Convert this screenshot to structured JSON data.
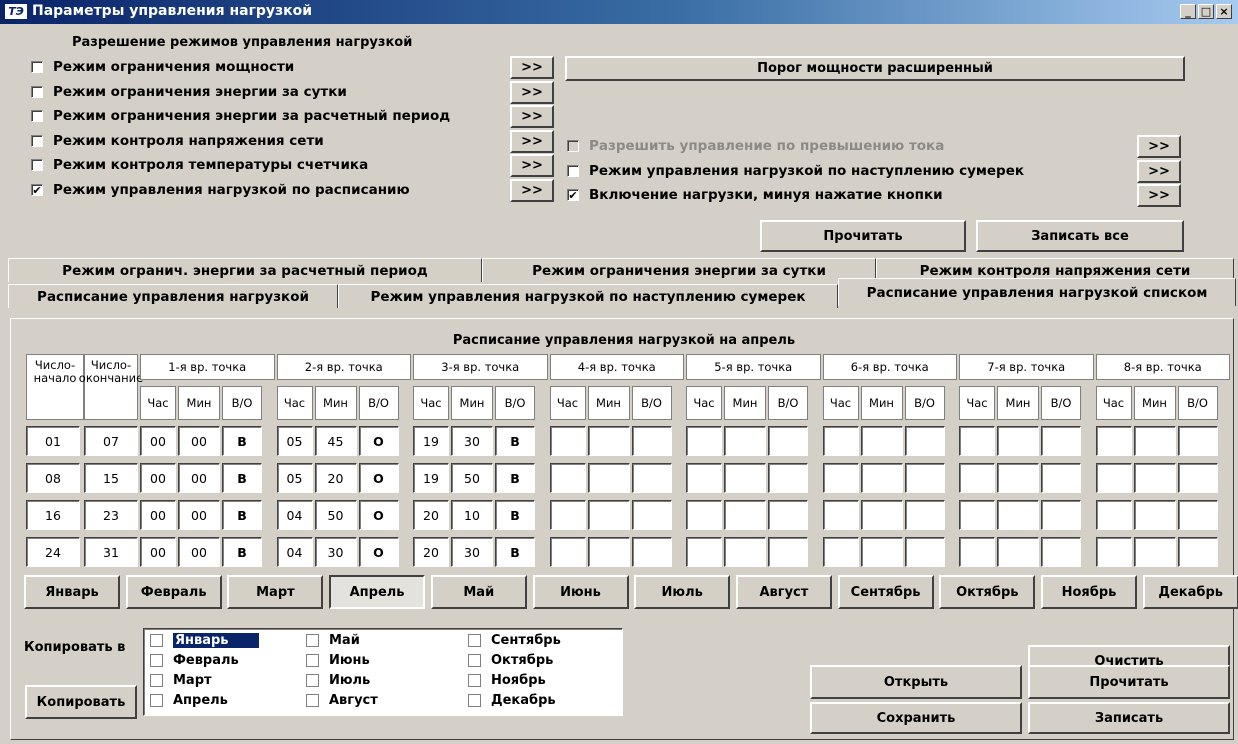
{
  "window": {
    "title": "Параметры управления нагрузкой",
    "logo": "ТЭ",
    "min": "_",
    "max": "□",
    "close": "×"
  },
  "modes": {
    "header": "Разрешение режимов управления нагрузкой",
    "items": [
      {
        "label": "Режим ограничения мощности",
        "checked": false
      },
      {
        "label": "Режим ограничения энергии за сутки",
        "checked": false
      },
      {
        "label": "Режим ограничения энергии за расчетный период",
        "checked": false
      },
      {
        "label": "Режим контроля напряжения сети",
        "checked": false
      },
      {
        "label": "Режим контроля температуры счетчика",
        "checked": false
      },
      {
        "label": "Режим управления нагрузкой по расписанию",
        "checked": true
      }
    ],
    "more": ">>"
  },
  "right": {
    "threshold_button": "Порог мощности расширенный",
    "options": [
      {
        "label": "Разрешить управление по превышению тока",
        "checked": false,
        "disabled": true
      },
      {
        "label": "Режим управления нагрузкой по наступлению сумерек",
        "checked": false,
        "disabled": false
      },
      {
        "label": "Включение нагрузки, минуя нажатие кнопки",
        "checked": true,
        "disabled": false
      }
    ],
    "read": "Прочитать",
    "write_all": "Записать все"
  },
  "tabs": {
    "row1": [
      "Режим огранич. энергии за расчетный период",
      "Режим ограничения энергии за сутки",
      "Режим контроля напряжения сети"
    ],
    "row2": [
      "Расписание управления нагрузкой",
      "Режим управления нагрузкой по наступлению сумерек",
      "Расписание управления нагрузкой списком"
    ]
  },
  "schedule": {
    "title": "Расписание управления нагрузкой на апрель",
    "col_start": "Число-начало",
    "col_end": "Число-окончание",
    "points": [
      "1-я вр. точка",
      "2-я вр. точка",
      "3-я вр. точка",
      "4-я вр. точка",
      "5-я вр. точка",
      "6-я вр. точка",
      "7-я вр. точка",
      "8-я вр. точка"
    ],
    "sub": [
      "Час",
      "Мин",
      "В/О"
    ],
    "rows": [
      {
        "start": "01",
        "end": "07",
        "cells": [
          "00",
          "00",
          "В",
          "05",
          "45",
          "О",
          "19",
          "30",
          "В"
        ]
      },
      {
        "start": "08",
        "end": "15",
        "cells": [
          "00",
          "00",
          "В",
          "05",
          "20",
          "О",
          "19",
          "50",
          "В"
        ]
      },
      {
        "start": "16",
        "end": "23",
        "cells": [
          "00",
          "00",
          "В",
          "04",
          "50",
          "О",
          "20",
          "10",
          "В"
        ]
      },
      {
        "start": "24",
        "end": "31",
        "cells": [
          "00",
          "00",
          "В",
          "04",
          "30",
          "О",
          "20",
          "30",
          "В"
        ]
      }
    ]
  },
  "months": [
    "Январь",
    "Февраль",
    "Март",
    "Апрель",
    "Май",
    "Июнь",
    "Июль",
    "Август",
    "Сентябрь",
    "Октябрь",
    "Ноябрь",
    "Декабрь"
  ],
  "selected_month": "Апрель",
  "copy": {
    "label": "Копировать в",
    "button": "Копировать",
    "list": [
      [
        "Январь",
        "Февраль",
        "Март",
        "Апрель"
      ],
      [
        "Май",
        "Июнь",
        "Июль",
        "Август"
      ],
      [
        "Сентябрь",
        "Октябрь",
        "Ноябрь",
        "Декабрь"
      ]
    ],
    "selected": "Январь"
  },
  "actions": {
    "clear": "Очистить",
    "open": "Открыть",
    "read": "Прочитать",
    "save": "Сохранить",
    "write": "Записать"
  }
}
